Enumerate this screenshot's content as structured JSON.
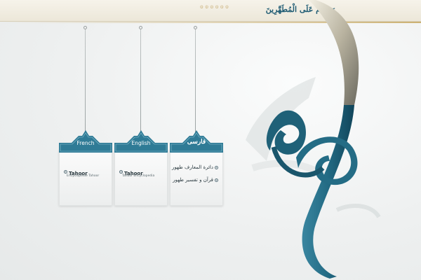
{
  "header": {
    "slogan": "وَسَلَامٌ عَلَى الْمُطَهَّرِينَ",
    "ornament": "۞ ۞ ۞ ۞ ۞ ۞"
  },
  "colors": {
    "teal": "#2b6f88",
    "teal_dark": "#14485e",
    "gold": "#b08a38"
  },
  "languages": [
    {
      "tag": "French",
      "links": [
        {
          "title": "Tahoor",
          "subtitle": "Encyclopédie Tahoor"
        }
      ]
    },
    {
      "tag": "English",
      "links": [
        {
          "title": "Tahoor",
          "subtitle": "Tahoor Encyclopedia"
        }
      ]
    },
    {
      "tag": "فارسی",
      "links": [
        {
          "title": "دائرة المعارف طهور"
        },
        {
          "title": "قرآن و تفسیر طهور"
        }
      ]
    }
  ],
  "icons": {
    "bullet": "circle-bullet-icon",
    "logo": "tahoor-calligraphy-logo"
  }
}
